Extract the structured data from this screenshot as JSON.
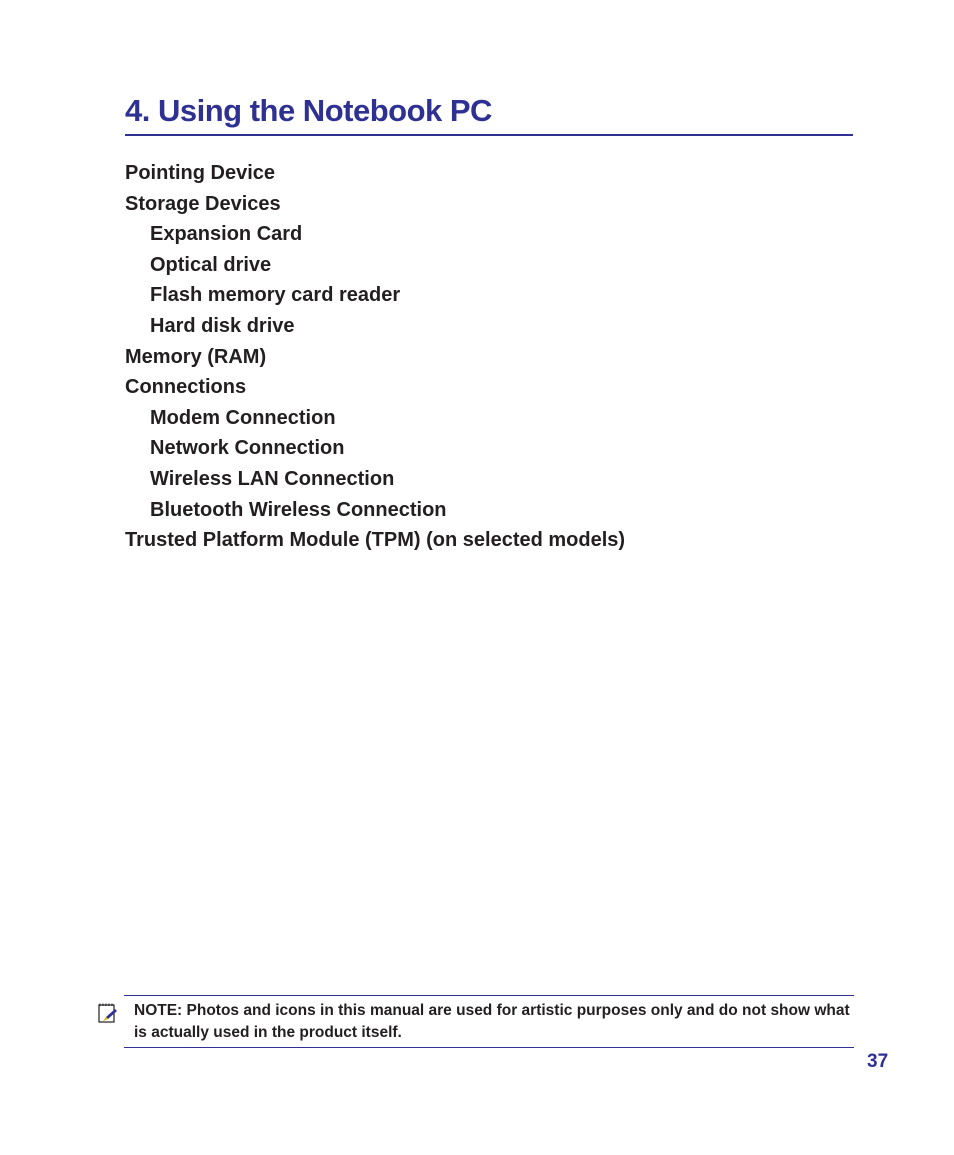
{
  "heading": {
    "title": "4. Using the Notebook PC",
    "accent_color": "#2e3192"
  },
  "toc": {
    "items": [
      {
        "label": "Pointing Device",
        "level": 1
      },
      {
        "label": "Storage Devices",
        "level": 1
      },
      {
        "label": "Expansion Card",
        "level": 2
      },
      {
        "label": "Optical drive",
        "level": 2
      },
      {
        "label": "Flash memory card reader",
        "level": 2
      },
      {
        "label": "Hard disk drive",
        "level": 2
      },
      {
        "label": "Memory (RAM)",
        "level": 1
      },
      {
        "label": "Connections",
        "level": 1
      },
      {
        "label": "Modem Connection",
        "level": 2
      },
      {
        "label": "Network Connection",
        "level": 2
      },
      {
        "label": "Wireless LAN Connection",
        "level": 2
      },
      {
        "label": "Bluetooth Wireless Connection",
        "level": 2
      },
      {
        "label": "Trusted Platform Module (TPM) (on selected models)",
        "level": 1
      }
    ]
  },
  "note": {
    "icon": "note-pencil-icon",
    "text": "NOTE: Photos and icons in this manual are used for artistic purposes only and do not show what is actually used in the product itself."
  },
  "footer": {
    "page_number": "37"
  }
}
